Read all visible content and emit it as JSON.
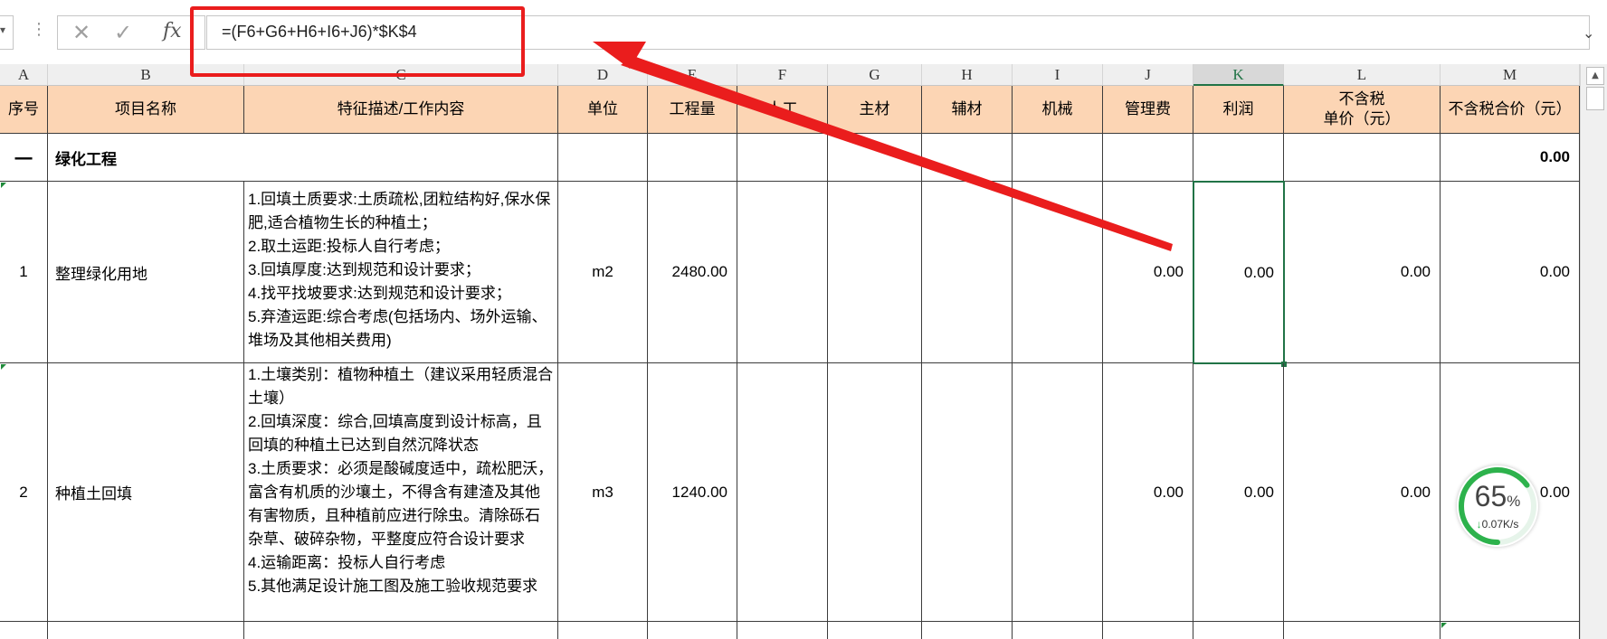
{
  "formula_bar": {
    "cancel_icon": "✕",
    "confirm_icon": "✓",
    "fx_label": "fx",
    "formula": "=(F6+G6+H6+I6+J6)*$K$4"
  },
  "columns": [
    "A",
    "B",
    "C",
    "D",
    "E",
    "F",
    "G",
    "H",
    "I",
    "J",
    "K",
    "L",
    "M"
  ],
  "selected_column": "K",
  "header_row": {
    "seq": "序号",
    "name": "项目名称",
    "desc": "特征描述/工作内容",
    "unit": "单位",
    "qty": "工程量",
    "labor": "人工",
    "main_mat": "主材",
    "aux_mat": "辅材",
    "machine": "机械",
    "mgmt": "管理费",
    "profit": "利润",
    "unit_price": "不含税\n单价（元）",
    "total": "不含税合价（元）"
  },
  "section": {
    "seq": "一",
    "name": "绿化工程",
    "total": "0.00"
  },
  "rows": [
    {
      "seq": "1",
      "name": "整理绿化用地",
      "desc": "1.回填土质要求:土质疏松,团粒结构好,保水保肥,适合植物生长的种植土；\n2.取土运距:投标人自行考虑；\n3.回填厚度:达到规范和设计要求；\n4.找平找坡要求:达到规范和设计要求；\n5.弃渣运距:综合考虑(包括场内、场外运输、堆场及其他相关费用)",
      "unit": "m2",
      "qty": "2480.00",
      "mgmt": "0.00",
      "profit": "0.00",
      "unit_price": "0.00",
      "total": "0.00"
    },
    {
      "seq": "2",
      "name": "种植土回填",
      "desc": "1.土壤类别：植物种植土（建议采用轻质混合土壤）\n2.回填深度：综合,回填高度到设计标高，且回填的种植土已达到自然沉降状态\n3.土质要求：必须是酸碱度适中，疏松肥沃，富含有机质的沙壤土，不得含有建渣及其他有害物质，且种植前应进行除虫。清除砾石杂草、破碎杂物，平整度应符合设计要求\n4.运输距离：投标人自行考虑\n5.其他满足设计施工图及施工验收规范要求",
      "unit": "m3",
      "qty": "1240.00",
      "mgmt": "0.00",
      "profit": "0.00",
      "unit_price": "0.00",
      "total": "0.00"
    }
  ],
  "speed_widget": {
    "percent": "65",
    "percent_unit": "%",
    "rate": "0.07K/s",
    "level": 0.65
  },
  "colors": {
    "header_fill": "#fcd5b4",
    "annotation_red": "#ea1d1d",
    "selection_green": "#217346",
    "widget_green": "#2db24c"
  }
}
